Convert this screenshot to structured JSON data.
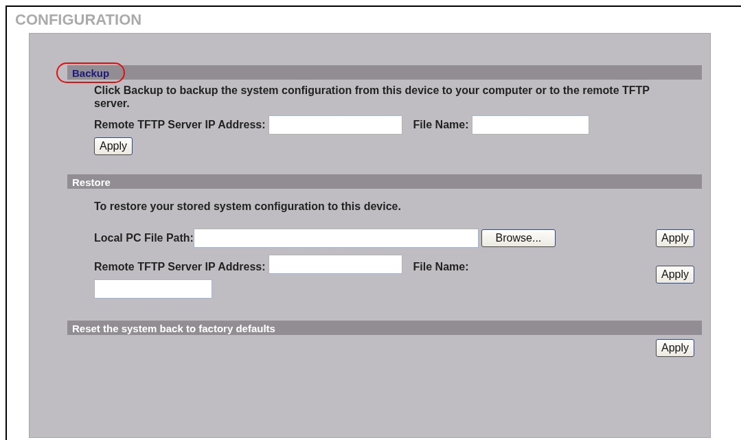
{
  "page_title": "CONFIGURATION",
  "sections": [
    {
      "kind": "backup",
      "heading": "Backup",
      "highlighted": true,
      "description": "Click Backup to backup the system configuration from this device to your computer or to the remote TFTP server.",
      "ip_label": "Remote TFTP Server IP Address:",
      "file_label": "File Name:",
      "apply": "Apply"
    },
    {
      "kind": "restore",
      "heading": "Restore",
      "highlighted": false,
      "description": "To restore your stored system configuration to this device.",
      "path_label": "Local PC File Path:",
      "browse": "Browse...",
      "path_apply": "Apply",
      "ip_label": "Remote TFTP Server IP Address:",
      "file_label": "File Name:",
      "apply": "Apply"
    },
    {
      "kind": "reset",
      "heading": "Reset the system back to factory defaults",
      "highlighted": false,
      "apply": "Apply"
    }
  ]
}
